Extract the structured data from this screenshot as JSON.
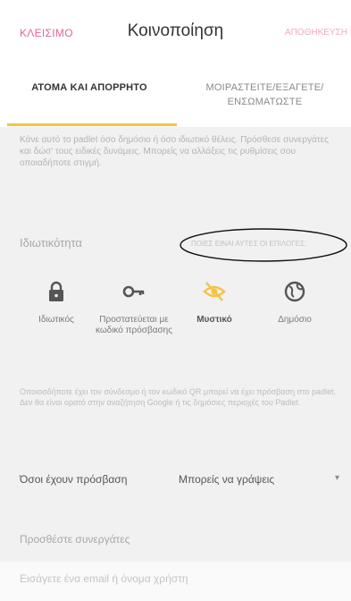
{
  "header": {
    "close_label": "ΚΛΕΙΣΙΜΟ",
    "title": "Κοινοποίηση",
    "save_label": "ΑΠΟΘΗΚΕΥΣΗ"
  },
  "tabs": [
    {
      "label": "ΑΤΟΜΑ ΚΑΙ ΑΠΟΡΡΗΤΟ",
      "active": true
    },
    {
      "label": "ΜΟΙΡΑΣΤΕΙΤΕ/ΕΞΑΓΕΤΕ/ ΕΝΣΩΜΑΤΩΣΤΕ",
      "active": false
    }
  ],
  "intro_text": "Κάνε αυτό το padlet όσο δημόσιο ή όσο ιδιωτικό θέλεις. Πρόσθεσε συνεργάτες και δώσ' τους ειδικές δυνάμεις. Μπορείς να αλλάξεις τις ρυθμίσεις σου οποιαδήποτε στιγμή.",
  "privacy": {
    "label": "Ιδιωτικότητα",
    "link_text": "ΠΟΙΕΣ ΕΙΝΑΙ ΑΥΤΕΣ ΟΙ ΕΠΙΛΟΓΕΣ;",
    "options": [
      {
        "label": "Ιδιωτικός",
        "icon": "lock-icon",
        "selected": false
      },
      {
        "label": "Προστατεύεται με κωδικό πρόσβασης",
        "icon": "key-icon",
        "selected": false
      },
      {
        "label": "Μυστικό",
        "icon": "eye-slash-icon",
        "selected": true
      },
      {
        "label": "Δημόσιο",
        "icon": "globe-icon",
        "selected": false
      }
    ]
  },
  "note_text": "Οποιοσδήποτε έχει τον σύνδεσμο ή τον κωδικό QR μπορεί να έχει πρόσβαση στο padlet. Δεν θα είναι ορατό στην αναζήτηση Google ή τις δημόσιες περιοχές του Padlet.",
  "access": {
    "label": "Όσοι έχουν πρόσβαση",
    "value": "Μπορείς να γράψεις"
  },
  "collaborators": {
    "heading": "Προσθέστε συνεργάτες",
    "input_placeholder": "Εισάγετε ένα email ή όνομα χρήστη"
  },
  "colors": {
    "accent": "#f5c244",
    "pink": "#e0669a",
    "background": "#f1f1f1"
  }
}
